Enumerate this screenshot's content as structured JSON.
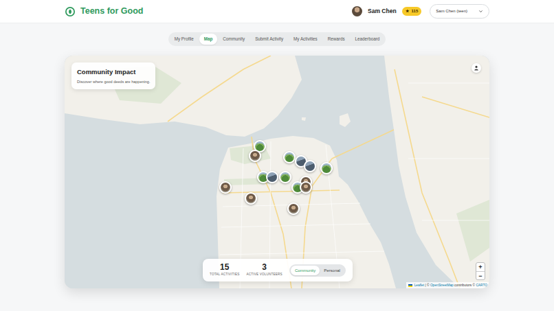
{
  "brand": {
    "name": "Teens for Good"
  },
  "user": {
    "name": "Sam Chen",
    "points_icon": "★",
    "points": "115",
    "account": "Sam Chen (teen)"
  },
  "tabs": [
    {
      "label": "My Profile",
      "selected": false
    },
    {
      "label": "Map",
      "selected": true
    },
    {
      "label": "Community",
      "selected": false
    },
    {
      "label": "Submit Activity",
      "selected": false
    },
    {
      "label": "My Activities",
      "selected": false
    },
    {
      "label": "Rewards",
      "selected": false
    },
    {
      "label": "Leaderboard",
      "selected": false
    }
  ],
  "map": {
    "title": "Community Impact",
    "subtitle": "Discover where good deeds are happening.",
    "pins": [
      {
        "kind": "park"
      },
      {
        "kind": "person"
      },
      {
        "kind": "park"
      },
      {
        "kind": "street"
      },
      {
        "kind": "street"
      },
      {
        "kind": "park"
      },
      {
        "kind": "park"
      },
      {
        "kind": "street"
      },
      {
        "kind": "park"
      },
      {
        "kind": "person"
      },
      {
        "kind": "park"
      },
      {
        "kind": "person"
      },
      {
        "kind": "person"
      },
      {
        "kind": "person"
      },
      {
        "kind": "person"
      }
    ],
    "stats": [
      {
        "value": "15",
        "label": "TOTAL ACTIVITIES"
      },
      {
        "value": "3",
        "label": "ACTIVE VOLUNTEERS"
      }
    ],
    "views": [
      {
        "label": "Community",
        "selected": true
      },
      {
        "label": "Personal",
        "selected": false
      }
    ],
    "zoom": [
      "+",
      "−"
    ],
    "attribution": [
      {
        "text": "Leaflet",
        "link": true
      },
      {
        "text": " | © ",
        "link": false
      },
      {
        "text": "OpenStreetMap",
        "link": true
      },
      {
        "text": " contributors © ",
        "link": false
      },
      {
        "text": "CARTO",
        "link": true
      }
    ]
  }
}
